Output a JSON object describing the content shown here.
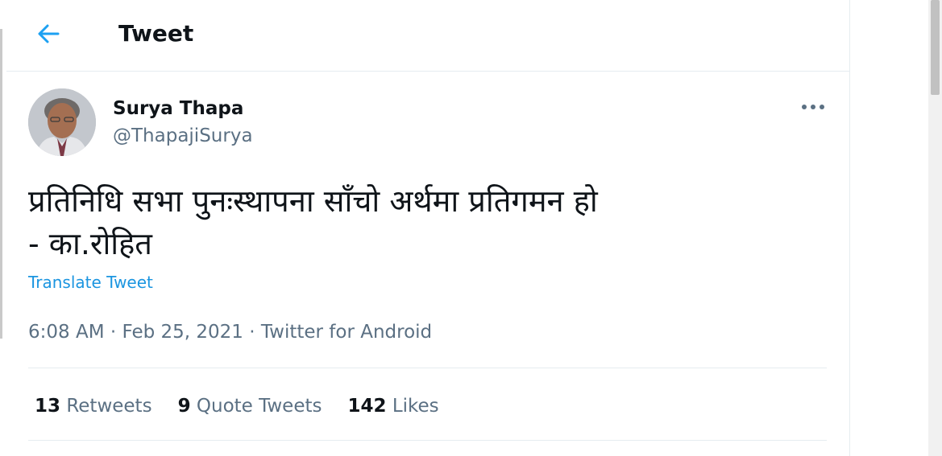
{
  "header": {
    "title": "Tweet"
  },
  "author": {
    "display_name": "Surya Thapa",
    "handle": "@ThapajiSurya"
  },
  "tweet": {
    "line1": "प्रतिनिधि सभा पुनःस्थापना साँचो अर्थमा प्रतिगमन हो",
    "line2": "- का.रोहित",
    "translate_label": "Translate Tweet",
    "time": "6:08 AM",
    "date": "Feb 25, 2021",
    "source": "Twitter for Android",
    "separator": " · "
  },
  "stats": {
    "retweets_count": "13",
    "retweets_label": "Retweets",
    "quote_count": "9",
    "quote_label": "Quote Tweets",
    "likes_count": "142",
    "likes_label": "Likes"
  },
  "icons": {
    "back": "back-arrow-icon",
    "more": "more-options-icon"
  },
  "colors": {
    "accent": "#1da1f2",
    "link": "#1b95e0",
    "secondary_text": "#5b7083",
    "primary_text": "#0f1419"
  }
}
